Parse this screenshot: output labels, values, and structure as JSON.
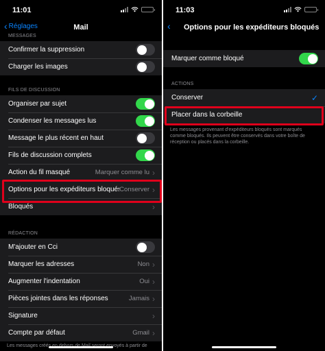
{
  "left": {
    "status_time": "11:01",
    "nav": {
      "back_label": "Réglages",
      "title": "Mail"
    },
    "section_top": "MESSAGES",
    "group_messages": [
      {
        "label": "Confirmer la suppression",
        "toggle": "off"
      },
      {
        "label": "Charger les images",
        "toggle": "off"
      }
    ],
    "section_threads": "FILS DE DISCUSSION",
    "group_threads": [
      {
        "label": "Organiser par sujet",
        "toggle": "on"
      },
      {
        "label": "Condenser les messages lus",
        "toggle": "on"
      },
      {
        "label": "Message le plus récent en haut",
        "toggle": "off"
      },
      {
        "label": "Fils de discussion complets",
        "toggle": "on"
      },
      {
        "label": "Action du fil masqué",
        "value": "Marquer comme lu"
      },
      {
        "label": "Options pour les expéditeurs bloqués",
        "value": "Conserver"
      },
      {
        "label": "Bloqués"
      }
    ],
    "section_compose": "RÉDACTION",
    "group_compose": [
      {
        "label": "M'ajouter en Cci",
        "toggle": "off"
      },
      {
        "label": "Marquer les adresses",
        "value": "Non"
      },
      {
        "label": "Augmenter l'indentation",
        "value": "Oui"
      },
      {
        "label": "Pièces jointes dans les réponses",
        "value": "Jamais"
      },
      {
        "label": "Signature"
      },
      {
        "label": "Compte par défaut",
        "value": "Gmail"
      }
    ],
    "bottom_note": "Les messages créés en dehors de Mail seront envoyés à partir de"
  },
  "right": {
    "status_time": "11:03",
    "nav": {
      "title": "Options pour les expéditeurs bloqués"
    },
    "mark_blocked": {
      "label": "Marquer comme bloqué",
      "toggle": "on"
    },
    "section_actions": "ACTIONS",
    "actions": [
      {
        "label": "Conserver",
        "selected": true
      },
      {
        "label": "Placer dans la corbeille",
        "selected": false
      }
    ],
    "footnote": "Les messages provenant d'expéditeurs bloqués sont marqués comme bloqués. Ils peuvent être conservés dans votre boîte de réception ou placés dans la corbeille."
  },
  "colors": {
    "accent": "#0a84ff",
    "toggle_on": "#32d74b",
    "highlight": "#e0001b"
  },
  "icons": {
    "back": "chevron-left-icon",
    "disclosure": "chevron-right-icon",
    "selected": "checkmark-icon"
  }
}
